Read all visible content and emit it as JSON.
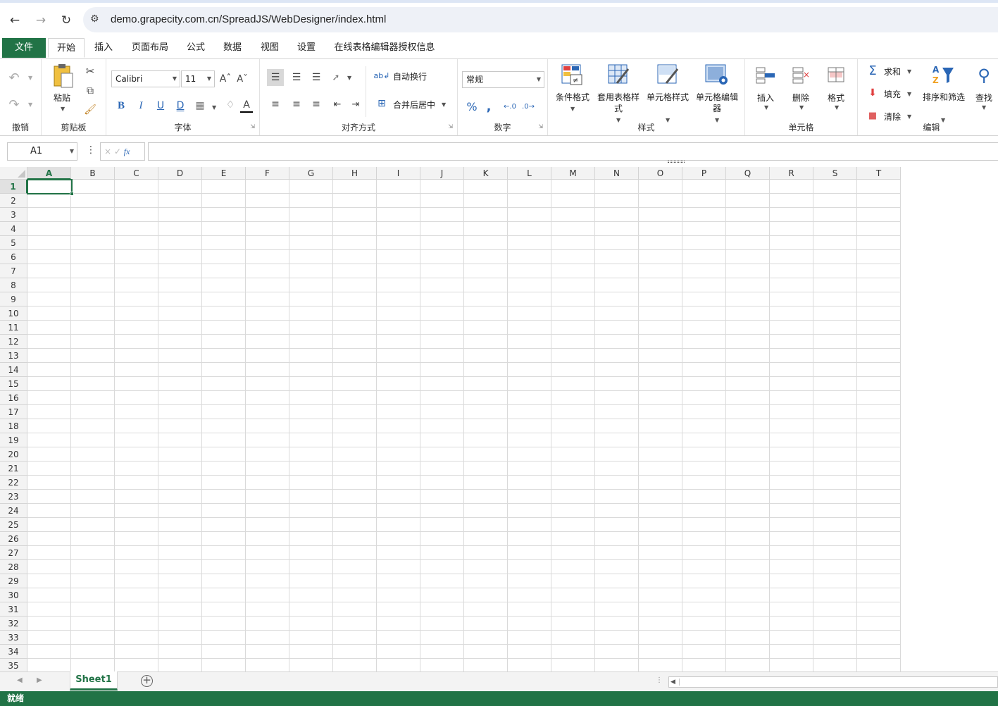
{
  "browser": {
    "url": "demo.grapecity.com.cn/SpreadJS/WebDesigner/index.html"
  },
  "tabs": {
    "file": "文件",
    "home": "开始",
    "insert": "插入",
    "page_layout": "页面布局",
    "formulas": "公式",
    "data": "数据",
    "view": "视图",
    "settings": "设置",
    "license": "在线表格编辑器授权信息"
  },
  "ribbon": {
    "undo_group": "撤销",
    "clipboard": {
      "paste": "粘贴",
      "group": "剪贴板"
    },
    "font": {
      "name": "Calibri",
      "size": "11",
      "group": "字体",
      "underline_double": "D"
    },
    "alignment": {
      "wrap": "自动换行",
      "merge": "合并后居中",
      "group": "对齐方式"
    },
    "number": {
      "format": "常规",
      "group": "数字"
    },
    "styles": {
      "conditional": "条件格式",
      "table_style": "套用表格样式",
      "cell_style": "单元格样式",
      "cell_editor": "单元格编辑器",
      "group": "样式"
    },
    "cells": {
      "insert": "插入",
      "delete": "删除",
      "format": "格式",
      "group": "单元格"
    },
    "editing": {
      "sum": "求和",
      "fill": "填充",
      "clear": "清除",
      "sort": "排序和筛选",
      "find": "查找",
      "group": "编辑"
    }
  },
  "formula_bar": {
    "cell_ref": "A1",
    "fx": "fx"
  },
  "grid": {
    "columns": [
      "A",
      "B",
      "C",
      "D",
      "E",
      "F",
      "G",
      "H",
      "I",
      "J",
      "K",
      "L",
      "M",
      "N",
      "O",
      "P",
      "Q",
      "R",
      "S",
      "T"
    ],
    "rows": [
      "1",
      "2",
      "3",
      "4",
      "5",
      "6",
      "7",
      "8",
      "9",
      "10",
      "11",
      "12",
      "13",
      "14",
      "15",
      "16",
      "17",
      "18",
      "19",
      "20",
      "21",
      "22",
      "23",
      "24",
      "25",
      "26",
      "27",
      "28",
      "29",
      "30",
      "31",
      "32",
      "33",
      "34",
      "35"
    ],
    "selected_column": "A",
    "selected_row": "1"
  },
  "sheets": {
    "active": "Sheet1"
  },
  "status": {
    "text": "就绪"
  },
  "colors": {
    "accent": "#217346",
    "icon_blue": "#2a66b5"
  }
}
